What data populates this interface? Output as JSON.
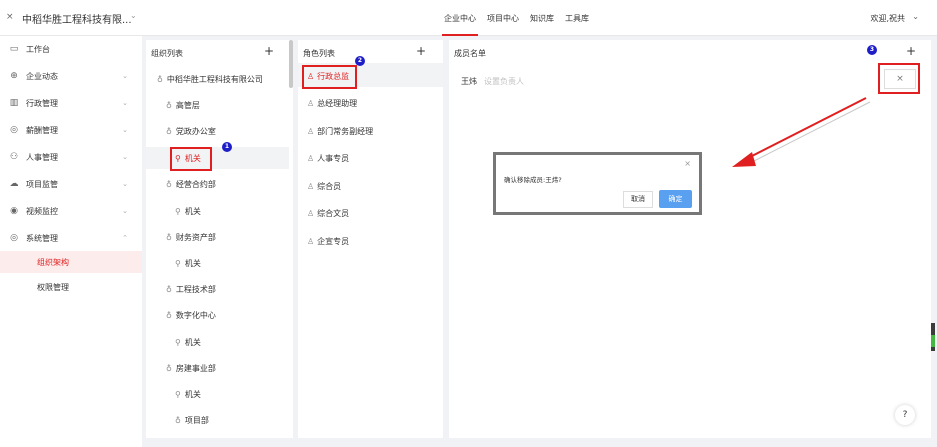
{
  "topbar": {
    "close_icon": "×",
    "company": "中稻华胜工程科技有限...",
    "caret": "⌄",
    "nav": [
      {
        "label": "企业中心",
        "active": true
      },
      {
        "label": "项目中心",
        "active": false
      },
      {
        "label": "知识库",
        "active": false
      },
      {
        "label": "工具库",
        "active": false
      }
    ],
    "welcome": "欢迎,祝共",
    "welcome_caret": "⌄"
  },
  "sidebar": {
    "items": [
      {
        "icon": "monitor-icon",
        "glyph": "▭",
        "label": "工作台",
        "has_caret": false
      },
      {
        "icon": "globe-icon",
        "glyph": "⊕",
        "label": "企业动态",
        "has_caret": true
      },
      {
        "icon": "building-icon",
        "glyph": "▥",
        "label": "行政管理",
        "has_caret": true
      },
      {
        "icon": "coin-icon",
        "glyph": "◎",
        "label": "薪酬管理",
        "has_caret": true
      },
      {
        "icon": "people-icon",
        "glyph": "⚇",
        "label": "人事管理",
        "has_caret": true
      },
      {
        "icon": "cloud-icon",
        "glyph": "☁",
        "label": "项目监管",
        "has_caret": true
      },
      {
        "icon": "camera-icon",
        "glyph": "◉",
        "label": "视频监控",
        "has_caret": true
      },
      {
        "icon": "settings-icon",
        "glyph": "◎",
        "label": "系统管理",
        "has_caret": true
      }
    ],
    "sub_items": [
      {
        "label": "组织架构",
        "active": true
      },
      {
        "label": "权限管理",
        "active": false
      }
    ],
    "caret_down": "⌄",
    "caret_up": "⌃"
  },
  "org": {
    "title": "组织列表",
    "add": "+",
    "root": "中稻华胜工程科技有限公司",
    "nodes": [
      {
        "label": "高管层",
        "type": "dept"
      },
      {
        "label": "党政办公室",
        "type": "dept"
      },
      {
        "label": "机关",
        "type": "office",
        "active": true
      },
      {
        "label": "经营合约部",
        "type": "dept"
      },
      {
        "label": "机关",
        "type": "office"
      },
      {
        "label": "财务资产部",
        "type": "dept"
      },
      {
        "label": "机关",
        "type": "office"
      },
      {
        "label": "工程技术部",
        "type": "dept"
      },
      {
        "label": "数字化中心",
        "type": "dept"
      },
      {
        "label": "机关",
        "type": "office"
      },
      {
        "label": "房建事业部",
        "type": "dept"
      },
      {
        "label": "机关",
        "type": "office"
      },
      {
        "label": "项目部",
        "type": "dept"
      }
    ],
    "dept_glyph": "♁",
    "office_glyph": "⚲"
  },
  "roles": {
    "title": "角色列表",
    "add": "+",
    "glyph": "♙",
    "items": [
      {
        "label": "行政总监",
        "active": true
      },
      {
        "label": "总经理助理",
        "active": false
      },
      {
        "label": "部门常务副经理",
        "active": false
      },
      {
        "label": "人事专员",
        "active": false
      },
      {
        "label": "综合员",
        "active": false
      },
      {
        "label": "综合文员",
        "active": false
      },
      {
        "label": "企宣专员",
        "active": false
      }
    ]
  },
  "members": {
    "title": "成员名单",
    "add": "+",
    "name": "王炜",
    "hint": "设置负责人",
    "remove_glyph": "×"
  },
  "dialog": {
    "close": "×",
    "message": "确认移除成员:王炜?",
    "cancel": "取消",
    "ok": "确定"
  },
  "badges": [
    "1",
    "2",
    "3"
  ],
  "help": "?",
  "colors": {
    "accent": "#e02020",
    "primary_button": "#5aa0f0",
    "badge": "#1e1ec8"
  }
}
